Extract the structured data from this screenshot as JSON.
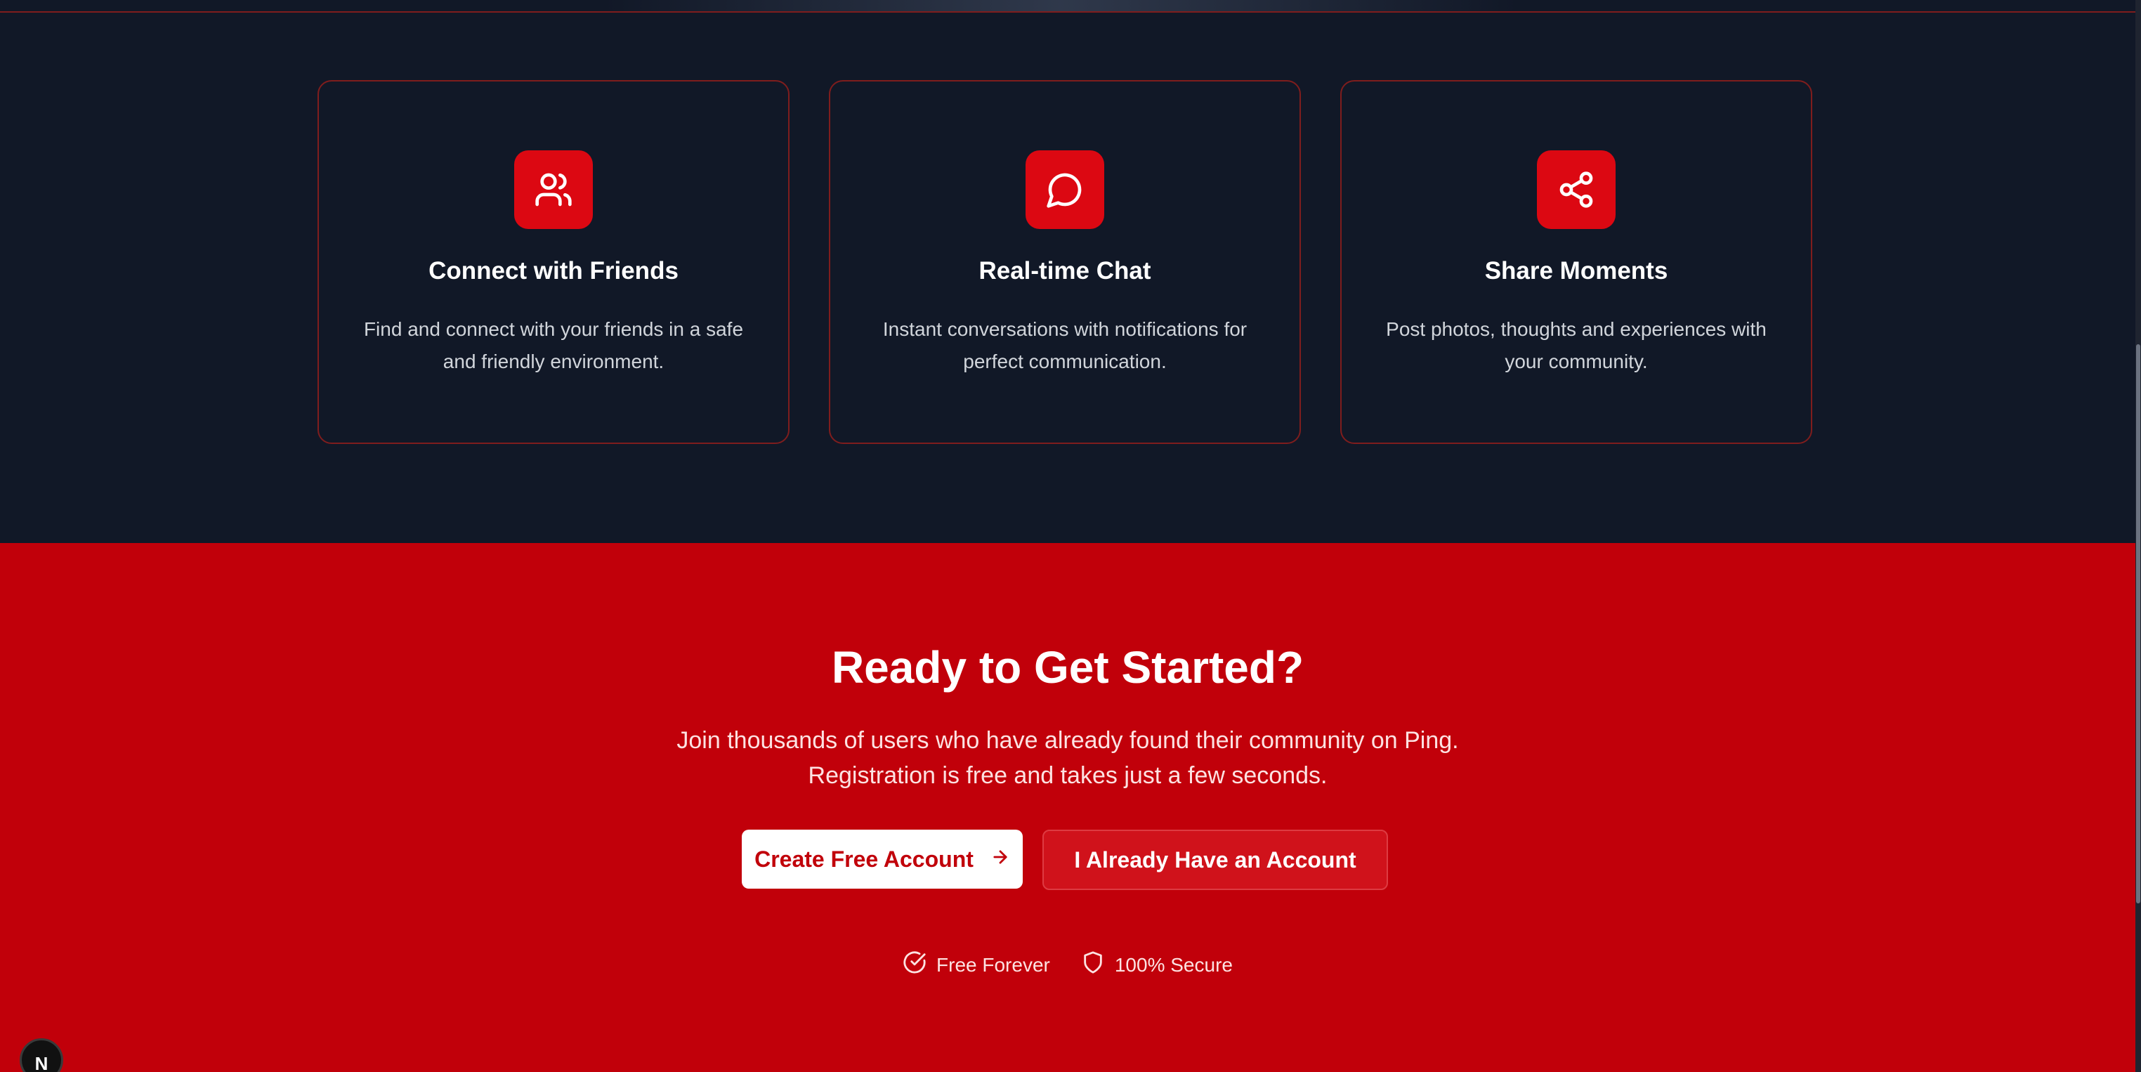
{
  "features": {
    "cards": [
      {
        "icon": "users-icon",
        "title": "Connect with Friends",
        "desc_line1": "Find and connect with your friends in a safe",
        "desc_line2": "and friendly environment."
      },
      {
        "icon": "message-circle-icon",
        "title": "Real-time Chat",
        "desc_line1": "Instant conversations with notifications for",
        "desc_line2": "perfect communication."
      },
      {
        "icon": "share-icon",
        "title": "Share Moments",
        "desc_line1": "Post photos, thoughts and experiences with",
        "desc_line2": "your community."
      }
    ]
  },
  "cta": {
    "title": "Ready to Get Started?",
    "subtitle_line1": "Join thousands of users who have already found their community on Ping.",
    "subtitle_line2": "Registration is free and takes just a few seconds.",
    "primary_button": "Create Free Account",
    "primary_button_icon": "arrow-right-icon",
    "secondary_button": "I Already Have an Account",
    "badges": [
      {
        "icon": "circle-check-icon",
        "label": "Free Forever"
      },
      {
        "icon": "shield-icon",
        "label": "100% Secure"
      }
    ]
  },
  "dev_badge": {
    "label": "N"
  },
  "colors": {
    "background_dark": "#111827",
    "accent_red": "#dc0812",
    "cta_red": "#c1000a",
    "card_border": "#7f1d1d",
    "white": "#ffffff"
  }
}
